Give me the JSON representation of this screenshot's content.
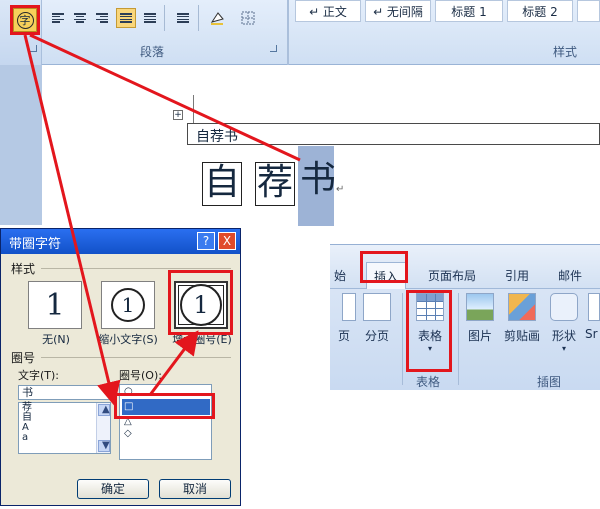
{
  "ribbon": {
    "groups": {
      "paragraph": "段落",
      "styles": "样式"
    },
    "style_tiles": [
      "↵ 正文",
      "↵ 无间隔",
      "标题 1",
      "标题 2"
    ],
    "circle_button_glyph": "字",
    "icons": [
      "align-left-icon",
      "align-center-icon",
      "align-right-icon",
      "justify-icon",
      "distributed-icon",
      "line-spacing-icon",
      "shading-icon",
      "borders-icon"
    ],
    "active_color": "#f7d05a"
  },
  "document": {
    "table_cell_text": "自荐书",
    "chars": [
      "自",
      "荐",
      "书"
    ],
    "paragraph_mark": "↵"
  },
  "insert_ribbon": {
    "tabs": [
      "始",
      "插入",
      "页面布局",
      "引用",
      "邮件"
    ],
    "buttons": [
      "页",
      "分页",
      "表格",
      "图片",
      "剪贴画",
      "形状",
      "Sr"
    ],
    "groups": [
      "表格",
      "插图"
    ]
  },
  "dialog": {
    "title": "带圈字符",
    "help": "?",
    "close": "X",
    "style_label": "样式",
    "styles": [
      {
        "glyph": "1",
        "label": "无(N)"
      },
      {
        "glyph": "①",
        "label": "缩小文字(S)"
      },
      {
        "glyph": "①",
        "label": "增大圈号(E)"
      }
    ],
    "circle_section_label": "圈号",
    "text_label": "文字(T):",
    "ring_label": "圈号(O):",
    "text_value": "书",
    "text_list": [
      "荐",
      "自",
      "A",
      "a"
    ],
    "ring_list": [
      "○",
      "□",
      "△",
      "◇"
    ],
    "ok": "确定",
    "cancel": "取消"
  },
  "annotation_color": "#e3161d"
}
